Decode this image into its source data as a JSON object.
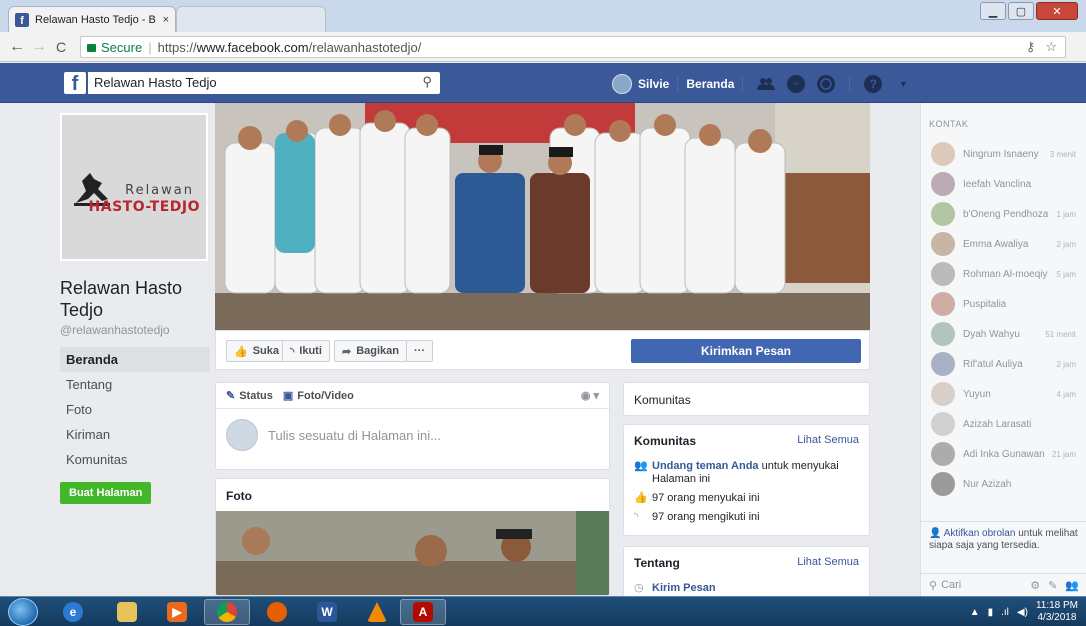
{
  "browser": {
    "tab_title": "Relawan Hasto Tedjo - B",
    "tab_close": "×",
    "secure_label": "Secure",
    "url_scheme": "https://",
    "url_host": "www.facebook.com",
    "url_path": "/relawanhastotedjo/",
    "back_glyph": "←",
    "forward_glyph": "→",
    "reload_glyph": "C",
    "win_min": "▁",
    "win_max": "▢",
    "win_close": "✕"
  },
  "fb": {
    "logo": "f",
    "search_value": "Relawan Hasto Tedjo",
    "user_name": "Silvie",
    "home_label": "Beranda"
  },
  "page": {
    "logo_line1": "Relawan",
    "logo_line2": "HASTO-TEDJO",
    "name": "Relawan Hasto Tedjo",
    "handle": "@relawanhastotedjo",
    "nav": [
      "Beranda",
      "Tentang",
      "Foto",
      "Kiriman",
      "Komunitas"
    ],
    "create_page_label": "Buat Halaman"
  },
  "actions": {
    "like": "Suka",
    "follow": "Ikuti",
    "share": "Bagikan",
    "more": "···",
    "send_message": "Kirimkan Pesan"
  },
  "composer": {
    "status_tab": "Status",
    "photo_tab": "Foto/Video",
    "placeholder": "Tulis sesuatu di Halaman ini..."
  },
  "foto": {
    "title": "Foto"
  },
  "komunitas_small": {
    "title": "Komunitas"
  },
  "komunitas": {
    "title": "Komunitas",
    "see_all": "Lihat Semua",
    "invite_link": "Undang teman Anda",
    "invite_rest": "untuk menyukai Halaman ini",
    "likes": "97 orang menyukai ini",
    "follows": "97 orang mengikuti ini"
  },
  "tentang": {
    "title": "Tentang",
    "see_all": "Lihat Semua",
    "send_message": "Kirim Pesan"
  },
  "chat": {
    "header": "KONTAK",
    "contacts": [
      {
        "name": "Ningrum Isnaeny",
        "time": "3 menit",
        "color": "#c9a38a"
      },
      {
        "name": "Ieefah Vanclina",
        "time": "",
        "color": "#8a6f7a"
      },
      {
        "name": "b'Oneng Pendhoza",
        "time": "1 jam",
        "color": "#7aa05a"
      },
      {
        "name": "Emma Awaliya",
        "time": "2 jam",
        "color": "#a08060"
      },
      {
        "name": "Rohman Al-moeqiy",
        "time": "5 jam",
        "color": "#8a8a8a"
      },
      {
        "name": "Puspitalia",
        "time": "",
        "color": "#b07060"
      },
      {
        "name": "Dyah Wahyu",
        "time": "51 menit",
        "color": "#7a9a8a"
      },
      {
        "name": "Rif'atul Auliya",
        "time": "2 jam",
        "color": "#6a7a9a"
      },
      {
        "name": "Yuyun",
        "time": "4 jam",
        "color": "#c0b0a0"
      },
      {
        "name": "Azizah Larasati",
        "time": "",
        "color": "#b0b0b0"
      },
      {
        "name": "Adi Inka Gunawan",
        "time": "21 jam",
        "color": "#707070"
      },
      {
        "name": "Nur Azizah",
        "time": "",
        "color": "#505050"
      }
    ],
    "activate_link": "Aktifkan obrolan",
    "activate_rest": "untuk melihat siapa saja yang tersedia.",
    "search_placeholder": "Cari"
  },
  "taskbar": {
    "time": "11:18 PM",
    "date": "4/3/2018"
  },
  "colors": {
    "fb_blue": "#3b5998",
    "button_blue": "#4267b2",
    "green": "#42b72a",
    "link": "#365899"
  }
}
